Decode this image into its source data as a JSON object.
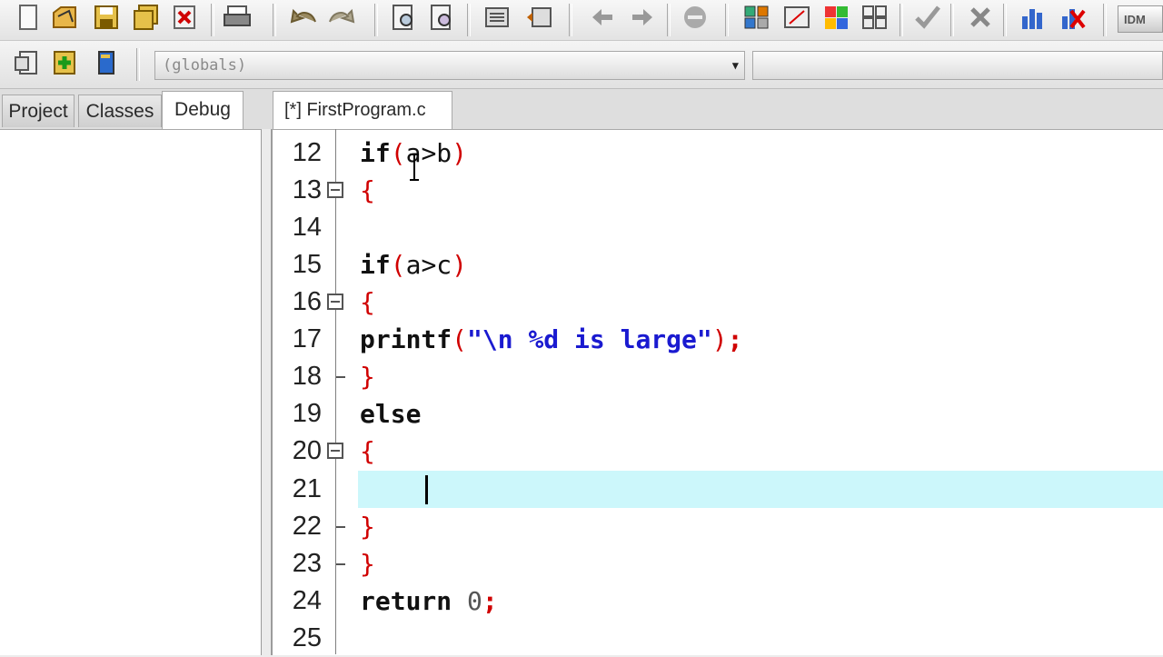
{
  "toolbar_row1": {
    "icons": [
      "new-file-icon",
      "open-file-icon",
      "save-icon",
      "save-all-icon",
      "close-icon",
      "print-icon",
      "undo-icon",
      "redo-icon",
      "find-icon",
      "replace-icon",
      "indent-icon",
      "unindent-icon",
      "back-icon",
      "forward-icon",
      "bookmark-icon",
      "grid-icon",
      "window-icon",
      "color-grid-icon",
      "layout-icon",
      "compile-check-icon",
      "delete-icon",
      "chart-icon",
      "chart-error-icon"
    ],
    "right_label": "IDM"
  },
  "toolbar_row2": {
    "scope_select": "(globals)",
    "icons": [
      "project-icon",
      "add-icon",
      "book-icon"
    ]
  },
  "left_panel": {
    "tabs": [
      "Project",
      "Classes",
      "Debug"
    ],
    "active_tab": "Debug"
  },
  "editor": {
    "tab_label": "[*] FirstProgram.c",
    "current_line": 21,
    "lines": [
      {
        "num": "12",
        "text": "if(a>b)"
      },
      {
        "num": "13",
        "text": "{"
      },
      {
        "num": "14",
        "text": ""
      },
      {
        "num": "15",
        "text": "if(a>c)"
      },
      {
        "num": "16",
        "text": "{"
      },
      {
        "num": "17",
        "text": "printf(\"\\n %d is large\");"
      },
      {
        "num": "18",
        "text": "}"
      },
      {
        "num": "19",
        "text": "else"
      },
      {
        "num": "20",
        "text": "{"
      },
      {
        "num": "21",
        "text": ""
      },
      {
        "num": "22",
        "text": "}"
      },
      {
        "num": "23",
        "text": "}"
      },
      {
        "num": "24",
        "text": "return 0;"
      },
      {
        "num": "25",
        "text": ""
      }
    ]
  },
  "colors": {
    "keyword": "#111111",
    "brace": "#d00000",
    "string": "#1a1ad0",
    "current_line_bg": "#ccf7fb"
  }
}
